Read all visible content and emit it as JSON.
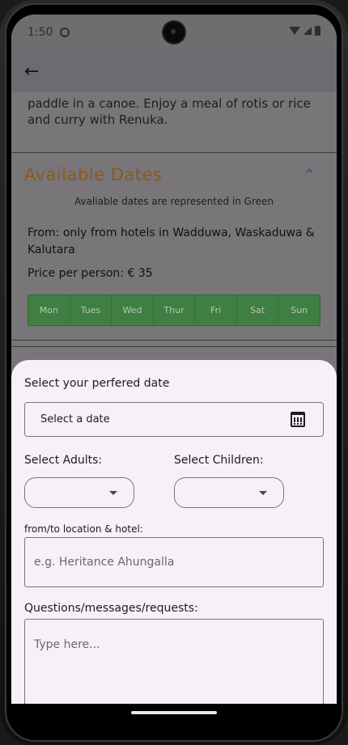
{
  "status_bar": {
    "time": "1:50"
  },
  "appbar": {
    "back_icon": "arrow-left-icon"
  },
  "background": {
    "description": "paddle in a canoe. Enjoy a meal of rotis or rice and curry with Renuka.",
    "section_title": "Available Dates",
    "availability_note": "Avaliable dates are represented in Green",
    "from": "From: only from hotels in Wadduwa, Waskaduwa & Kalutara",
    "price": "Price per person: € 35",
    "days": [
      "Mon",
      "Tues",
      "Wed",
      "Thur",
      "Fri",
      "Sat",
      "Sun"
    ],
    "available_color": "#3f7f42"
  },
  "sheet": {
    "date_label": "Select your perfered date",
    "date_field": "Select a date",
    "adults_label": "Select Adults:",
    "children_label": "Select Children:",
    "adults_value": "",
    "children_value": "",
    "location_label": "from/to location & hotel:",
    "location_placeholder": "e.g. Heritance Ahungalla",
    "questions_label": "Questions/messages/requests:",
    "questions_placeholder": "Type here..."
  }
}
